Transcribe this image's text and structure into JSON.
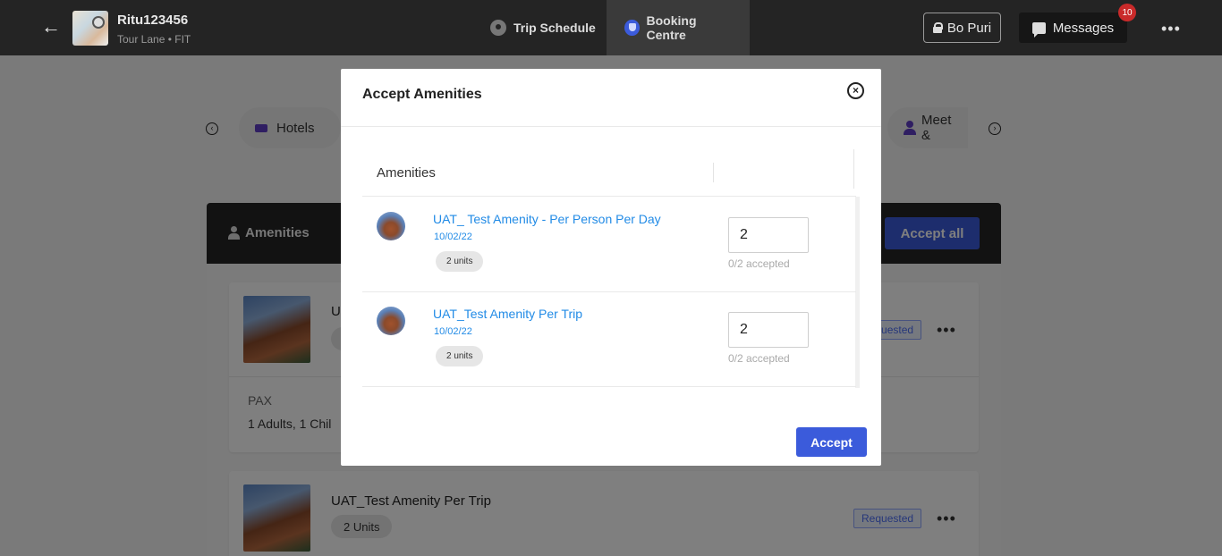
{
  "header": {
    "trip_name": "Ritu123456",
    "trip_subtitle": "Tour Lane • FIT",
    "tabs": [
      {
        "label": "Trip Schedule",
        "icon": "map-pin-icon"
      },
      {
        "label": "Booking Centre",
        "icon": "shield-icon",
        "active": true
      }
    ],
    "user_label": "Bo Puri",
    "messages_label": "Messages",
    "messages_count": "10"
  },
  "categories": {
    "items": [
      {
        "label": "Hotels",
        "icon": "bed-icon"
      },
      {
        "label": "Meet &",
        "icon": "person-icon"
      }
    ]
  },
  "background": {
    "section_title": "Amenities",
    "accept_all_label": "Accept all",
    "cards": [
      {
        "title_partial": "U",
        "status": "Requested",
        "pax_label": "PAX",
        "pax_value": "1 Adults, 1 Chil"
      },
      {
        "title": "UAT_Test Amenity Per Trip",
        "units": "2 Units",
        "status": "Requested"
      }
    ]
  },
  "modal": {
    "title": "Accept Amenities",
    "column_header": "Amenities",
    "accept_label": "Accept",
    "items": [
      {
        "name": "UAT_ Test Amenity - Per Person Per Day",
        "date": "10/02/22",
        "units": "2 units",
        "quantity": "2",
        "accepted": "0/2 accepted"
      },
      {
        "name": "UAT_Test Amenity Per Trip",
        "date": "10/02/22",
        "units": "2 units",
        "quantity": "2",
        "accepted": "0/2 accepted"
      }
    ]
  },
  "colors": {
    "primary": "#3b5bdb",
    "link": "#228be6",
    "topbar": "#242424",
    "badge": "#c92a2a"
  }
}
